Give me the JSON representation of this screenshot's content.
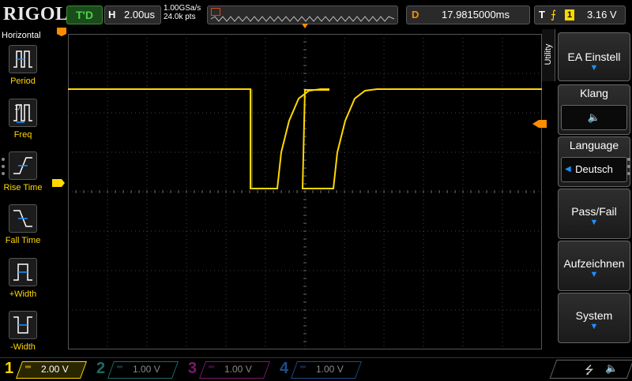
{
  "header": {
    "logo": "RIGOL",
    "trigger_status": "T'D",
    "h_label": "H",
    "timebase": "2.00us",
    "sample_rate": "1.00GSa/s",
    "memory_depth": "24.0k pts",
    "d_label": "D",
    "delay": "17.9815000ms",
    "t_label": "T",
    "trigger_source": "1",
    "trigger_level": "3.16 V"
  },
  "left_menu": {
    "title": "Horizontal",
    "items": [
      {
        "label": "Period",
        "icon": "period-icon"
      },
      {
        "label": "Freq",
        "icon": "freq-icon"
      },
      {
        "label": "Rise Time",
        "icon": "rise-time-icon"
      },
      {
        "label": "Fall Time",
        "icon": "fall-time-icon"
      },
      {
        "label": "+Width",
        "icon": "pos-width-icon"
      },
      {
        "label": "-Width",
        "icon": "neg-width-icon"
      }
    ]
  },
  "right_menu": {
    "tab": "Utility",
    "buttons": [
      {
        "label": "EA Einstell"
      },
      {
        "label": "Klang",
        "sub_icon": "speaker-icon",
        "sub_glyph": "🔈"
      },
      {
        "label": "Language",
        "sub": "Deutsch"
      },
      {
        "label": "Pass/Fail"
      },
      {
        "label": "Aufzeichnen"
      },
      {
        "label": "System"
      }
    ]
  },
  "channels": [
    {
      "num": "1",
      "scale": "2.00 V",
      "color": "#ffd800",
      "active": true
    },
    {
      "num": "2",
      "scale": "1.00 V",
      "color": "#1e8a8a",
      "active": false
    },
    {
      "num": "3",
      "scale": "1.00 V",
      "color": "#a0208c",
      "active": false
    },
    {
      "num": "4",
      "scale": "1.00 V",
      "color": "#1f5aa8",
      "active": false
    }
  ],
  "markers": {
    "channel1_ground": "1",
    "trigger_time": "T"
  },
  "colors": {
    "ch1": "#ffd800",
    "trigger": "#ff8c00",
    "accent": "#1e90ff",
    "status": "#4fd14f"
  }
}
